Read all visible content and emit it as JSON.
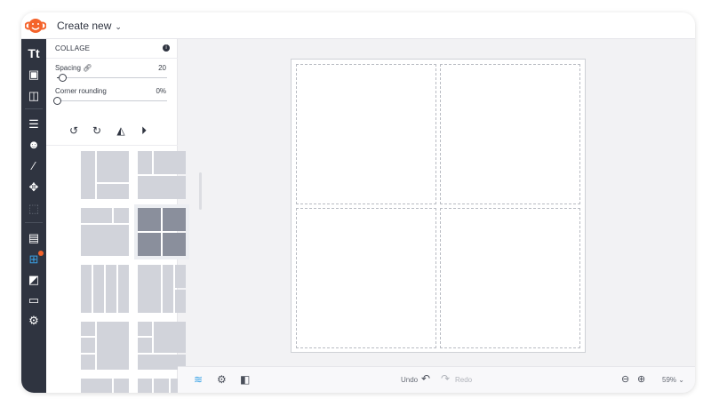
{
  "header": {
    "title": "Create new",
    "logo": "monkey-logo"
  },
  "sidebar": {
    "items": [
      {
        "name": "text",
        "glyph": "Tt"
      },
      {
        "name": "photo",
        "glyph": "▣"
      },
      {
        "name": "shapes",
        "glyph": "◫"
      },
      {
        "name": "adjust",
        "glyph": "☰"
      },
      {
        "name": "touch-up",
        "glyph": "☻"
      },
      {
        "name": "effects",
        "glyph": "⁄"
      },
      {
        "name": "textures",
        "glyph": "✥"
      },
      {
        "name": "frames",
        "glyph": "⬚"
      },
      {
        "name": "backgrounds",
        "glyph": "▤"
      },
      {
        "name": "collage",
        "glyph": "⊞"
      },
      {
        "name": "graphics",
        "glyph": "◩"
      },
      {
        "name": "comments",
        "glyph": "▭"
      },
      {
        "name": "settings",
        "glyph": "⚙"
      }
    ],
    "active": "collage",
    "badge_color": "#f4632b"
  },
  "panel": {
    "title": "COLLAGE",
    "spacing": {
      "label": "Spacing",
      "value": "20",
      "fraction": 0.05
    },
    "corner": {
      "label": "Corner rounding",
      "value": "0%",
      "fraction": 0
    },
    "tools": [
      "rotate-left",
      "rotate-right",
      "flip-horizontal",
      "flip-vertical"
    ]
  },
  "bottom": {
    "undo": "Undo",
    "redo": "Redo",
    "zoom": "59%"
  },
  "colors": {
    "accent": "#3ba3e6",
    "sidebar": "#2f3440"
  }
}
